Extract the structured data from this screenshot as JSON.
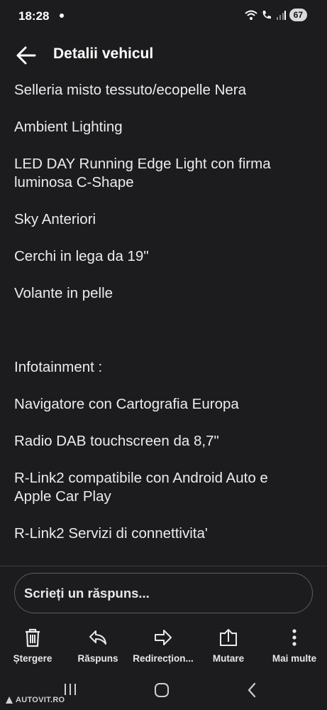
{
  "status": {
    "time": "18:28",
    "battery": "67"
  },
  "header": {
    "title": "Detalii vehicul"
  },
  "content_lines": [
    "Selleria misto tessuto/ecopelle Nera",
    "",
    "Ambient Lighting",
    "",
    "LED DAY Running Edge Light con firma",
    "luminosa C-Shape",
    "",
    "Sky Anteriori",
    "",
    "Cerchi in lega da 19\"",
    "",
    "Volante in pelle",
    "",
    "",
    "",
    "Infotainment :",
    "",
    "Navigatore con Cartografia Europa",
    "",
    "Radio DAB touchscreen da 8,7\"",
    "",
    "R-Link2 compatibile con Android Auto e",
    "Apple Car Play",
    "",
    "R-Link2 Servizi di connettivita'"
  ],
  "reply": {
    "placeholder": "Scrieți un răspuns..."
  },
  "actions": {
    "delete": "Ștergere",
    "reply": "Răspuns",
    "forward": "Redirecțion...",
    "move": "Mutare",
    "more": "Mai multe"
  },
  "watermark": "AUTOVIT.RO",
  "icons": {
    "back": "arrow-left-icon",
    "delete": "trash-icon",
    "reply": "reply-arrow-icon",
    "forward": "forward-arrow-icon",
    "move": "move-upload-icon",
    "more": "vertical-dots-icon"
  }
}
